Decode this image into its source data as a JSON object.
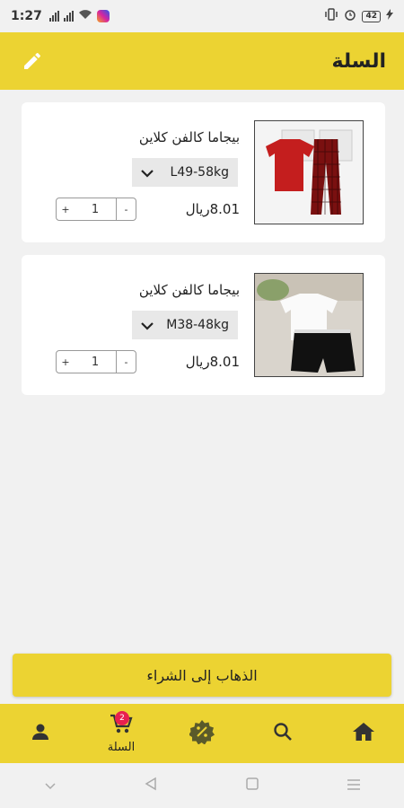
{
  "status_bar": {
    "time": "1:27",
    "battery": "42"
  },
  "header": {
    "title": "السلة"
  },
  "cart_items": [
    {
      "name": "بيجاما كالفن كلاين",
      "size": "L49-58kg",
      "price": "8.01ريال",
      "quantity": "1",
      "plus": "+",
      "minus": "-"
    },
    {
      "name": "بيجاما كالفن كلاين",
      "size": "M38-48kg",
      "price": "8.01ريال",
      "quantity": "1",
      "plus": "+",
      "minus": "-"
    }
  ],
  "checkout_label": "الذهاب إلى الشراء",
  "bottom_nav": {
    "cart_label": "السلة",
    "cart_badge": "2"
  },
  "colors": {
    "accent": "#ecd332",
    "badge": "#e8204f",
    "background": "#f1f1f1"
  }
}
